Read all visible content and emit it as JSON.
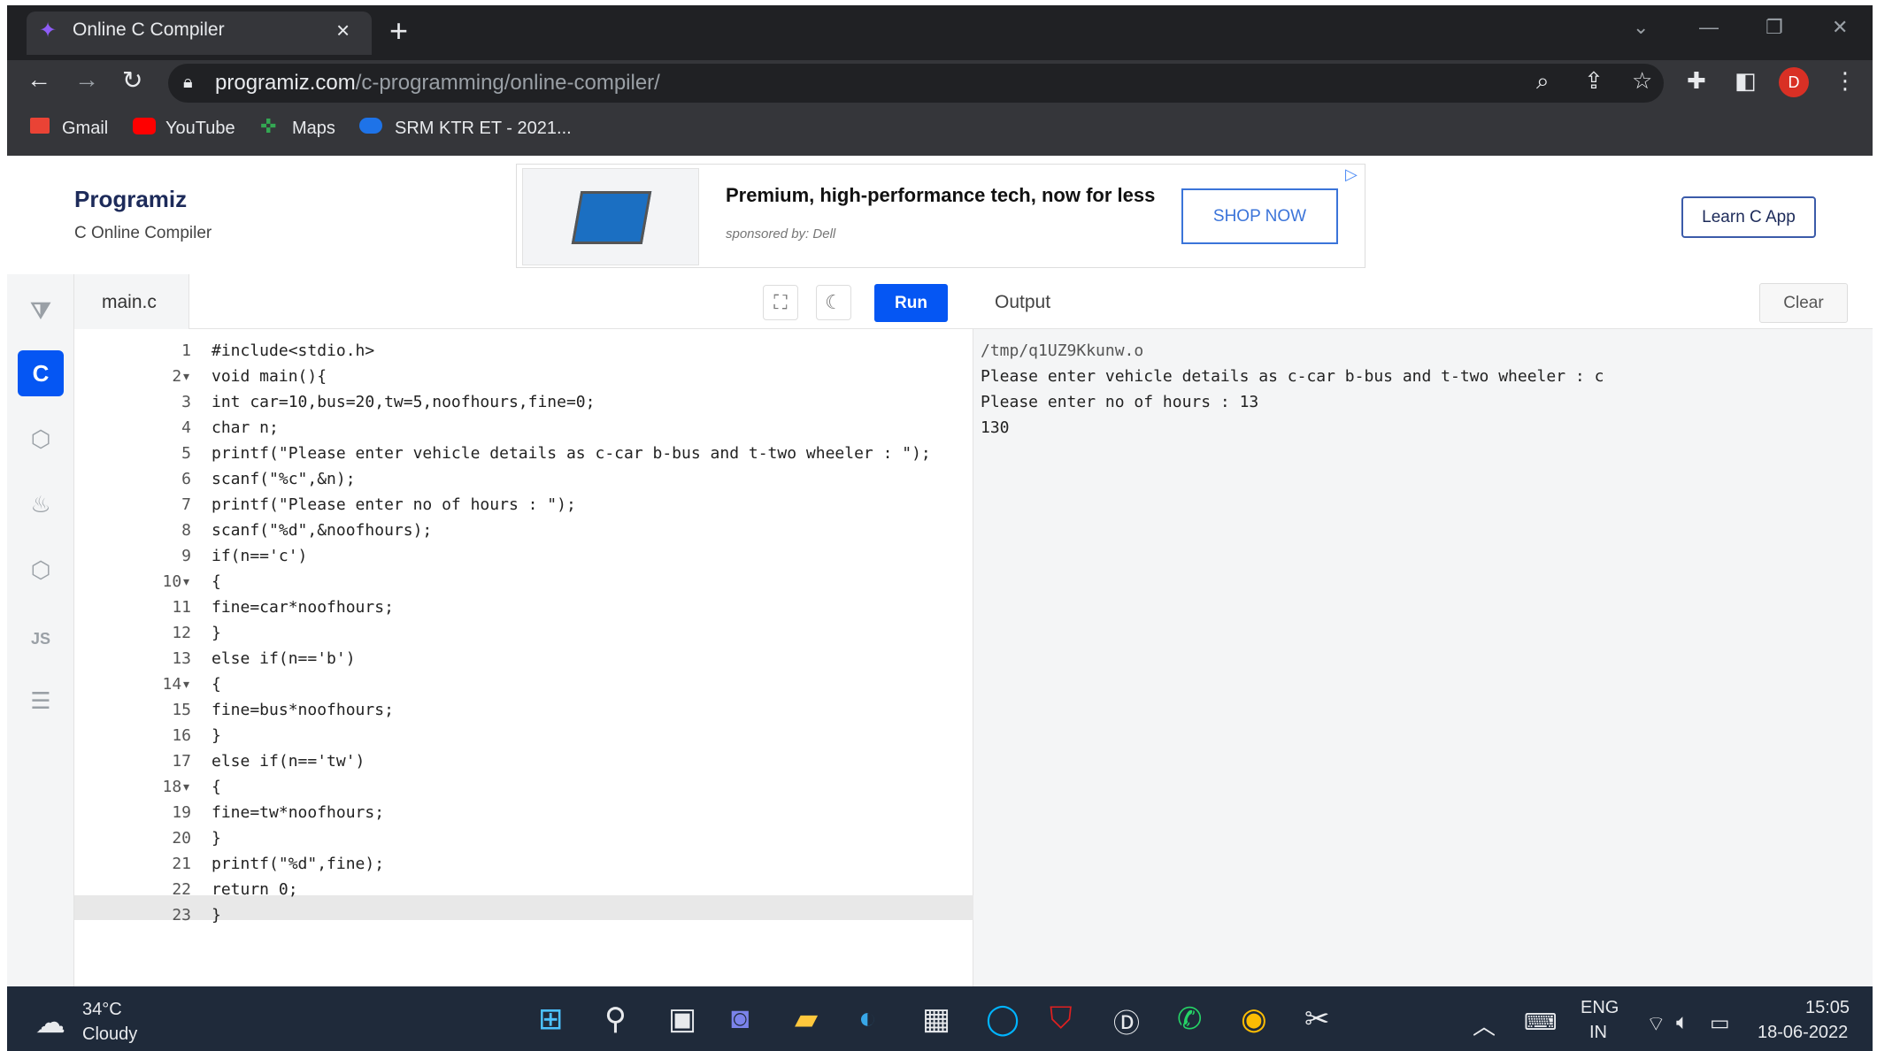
{
  "browser": {
    "tab_title": "Online C Compiler",
    "url_host": "programiz.com",
    "url_path": "/c-programming/online-compiler/",
    "bookmarks": [
      {
        "label": "Gmail"
      },
      {
        "label": "YouTube"
      },
      {
        "label": "Maps"
      },
      {
        "label": "SRM KTR ET - 2021..."
      }
    ],
    "profile_initial": "D"
  },
  "header": {
    "logo": "Programiz",
    "subtitle": "C Online Compiler",
    "ad": {
      "headline": "Premium, high-performance tech, now for less",
      "sponsor": "sponsored by: Dell",
      "cta": "SHOP NOW"
    },
    "learn_button": "Learn C App"
  },
  "sidebar": {
    "items": [
      {
        "name": "python",
        "label": "",
        "active": false
      },
      {
        "name": "c",
        "label": "C",
        "active": true
      },
      {
        "name": "cpp",
        "label": "",
        "active": false
      },
      {
        "name": "java",
        "label": "",
        "active": false
      },
      {
        "name": "csharp",
        "label": "",
        "active": false
      },
      {
        "name": "js",
        "label": "JS",
        "active": false
      },
      {
        "name": "sql",
        "label": "",
        "active": false
      }
    ]
  },
  "editor": {
    "filename": "main.c",
    "run_label": "Run",
    "lines": [
      {
        "n": "1",
        "code": "#include<stdio.h>"
      },
      {
        "n": "2▾",
        "code": "void main(){"
      },
      {
        "n": "3",
        "code": "int car=10,bus=20,tw=5,noofhours,fine=0;"
      },
      {
        "n": "4",
        "code": "char n;"
      },
      {
        "n": "5",
        "code": "printf(\"Please enter vehicle details as c-car b-bus and t-two wheeler : \");"
      },
      {
        "n": "6",
        "code": "scanf(\"%c\",&n);"
      },
      {
        "n": "7",
        "code": "printf(\"Please enter no of hours : \");"
      },
      {
        "n": "8",
        "code": "scanf(\"%d\",&noofhours);"
      },
      {
        "n": "9",
        "code": "if(n=='c')"
      },
      {
        "n": "10▾",
        "code": "{"
      },
      {
        "n": "11",
        "code": "fine=car*noofhours;"
      },
      {
        "n": "12",
        "code": "}"
      },
      {
        "n": "13",
        "code": "else if(n=='b')"
      },
      {
        "n": "14▾",
        "code": "{"
      },
      {
        "n": "15",
        "code": "fine=bus*noofhours;"
      },
      {
        "n": "16",
        "code": "}"
      },
      {
        "n": "17",
        "code": "else if(n=='tw')"
      },
      {
        "n": "18▾",
        "code": "{"
      },
      {
        "n": "19",
        "code": "fine=tw*noofhours;"
      },
      {
        "n": "20",
        "code": "}"
      },
      {
        "n": "21",
        "code": "printf(\"%d\",fine);"
      },
      {
        "n": "22",
        "code": "return 0;"
      },
      {
        "n": "23",
        "code": "}"
      }
    ]
  },
  "output": {
    "title": "Output",
    "clear_label": "Clear",
    "lines": [
      "/tmp/q1UZ9Kkunw.o",
      "Please enter vehicle details as c-car b-bus and t-two wheeler : c",
      "Please enter no of hours : 13",
      "130"
    ]
  },
  "taskbar": {
    "weather_temp": "34°C",
    "weather_desc": "Cloudy",
    "lang_top": "ENG",
    "lang_bottom": "IN",
    "time": "15:05",
    "date": "18-06-2022"
  }
}
